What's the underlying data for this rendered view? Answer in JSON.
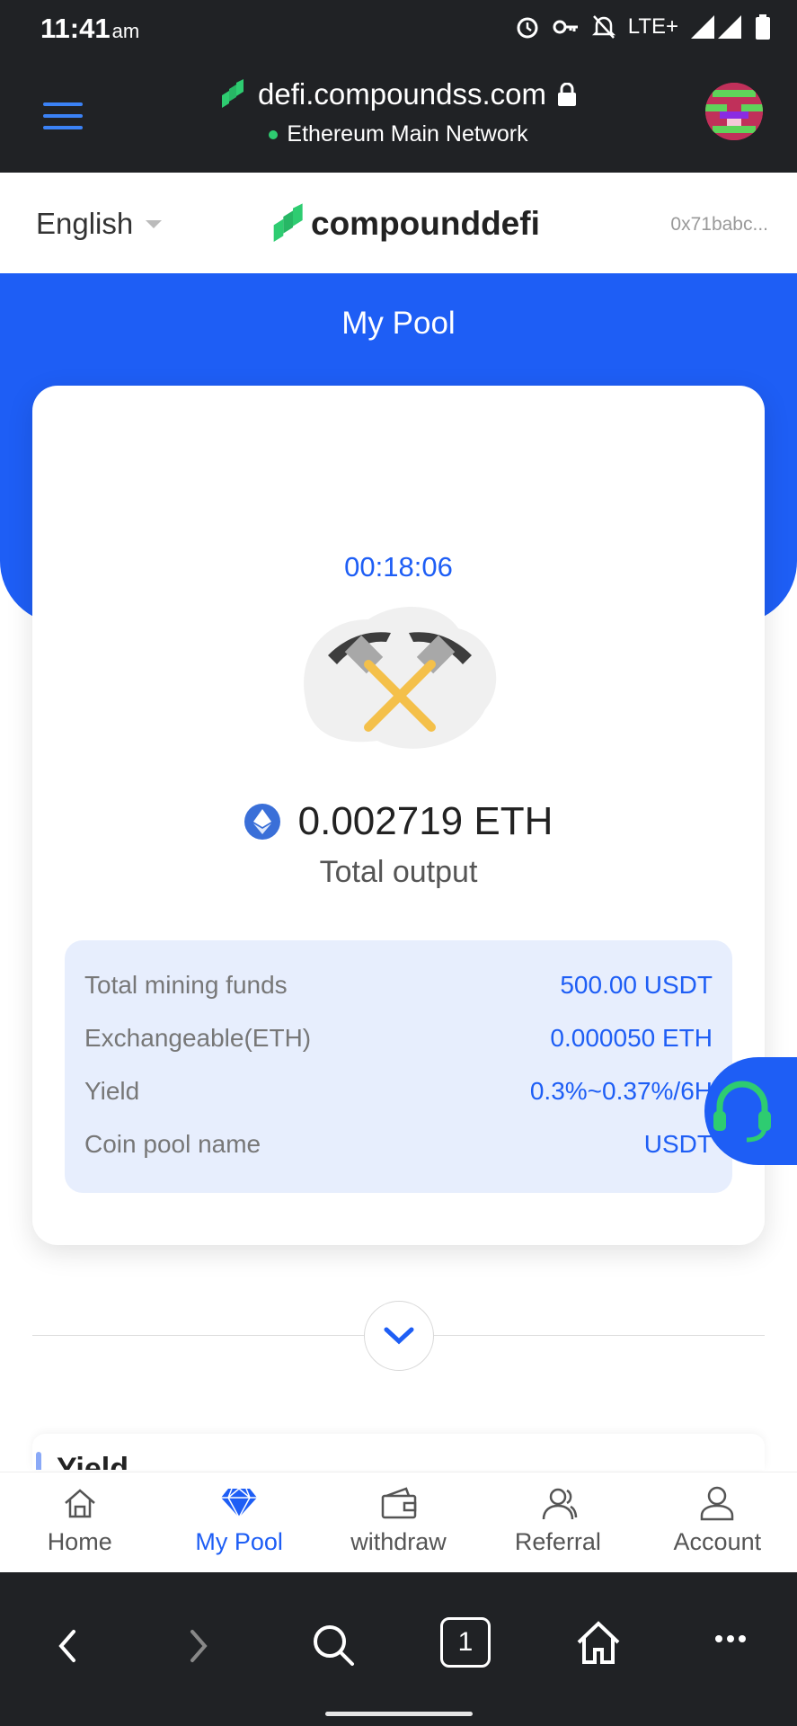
{
  "status_bar": {
    "time": "11:41",
    "ampm": "am",
    "network": "LTE+"
  },
  "browser": {
    "url": "defi.compoundss.com",
    "network_label": "Ethereum Main Network"
  },
  "header": {
    "language": "English",
    "brand": "compounddefi",
    "address": "0x71babc..."
  },
  "pool": {
    "title": "My Pool",
    "timer": "00:18:06",
    "output_amount": "0.002719 ETH",
    "output_label": "Total output",
    "details": [
      {
        "label": "Total mining funds",
        "value": "500.00 USDT"
      },
      {
        "label": "Exchangeable(ETH)",
        "value": "0.000050 ETH"
      },
      {
        "label": "Yield",
        "value": "0.3%~0.37%/6H"
      },
      {
        "label": "Coin pool name",
        "value": "USDT"
      }
    ]
  },
  "yield_section": {
    "title": "Yield"
  },
  "tabs": [
    {
      "label": "Home",
      "icon": "home-icon"
    },
    {
      "label": "My Pool",
      "icon": "diamond-icon",
      "active": true
    },
    {
      "label": "withdraw",
      "icon": "wallet-icon"
    },
    {
      "label": "Referral",
      "icon": "referral-icon"
    },
    {
      "label": "Account",
      "icon": "account-icon"
    }
  ],
  "browser_nav": {
    "tab_count": "1"
  },
  "colors": {
    "accent": "#1e5ef5",
    "brand_green": "#2ecc71",
    "dark_bar": "#202225"
  }
}
